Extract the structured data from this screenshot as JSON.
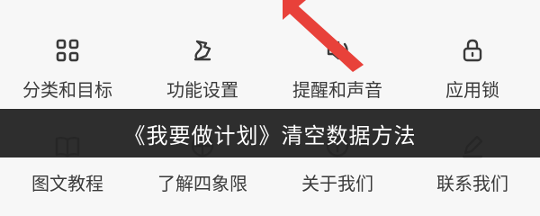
{
  "banner": {
    "text": "《我要做计划》清空数据方法"
  },
  "settings_grid": {
    "row1": [
      {
        "label": "分类和目标",
        "icon": "grid-icon"
      },
      {
        "label": "功能设置",
        "icon": "feature-settings-icon"
      },
      {
        "label": "提醒和声音",
        "icon": "sound-icon"
      },
      {
        "label": "应用锁",
        "icon": "lock-icon"
      }
    ],
    "row2": [
      {
        "label": "图文教程",
        "icon": "book-icon"
      },
      {
        "label": "了解四象限",
        "icon": "quadrant-icon"
      },
      {
        "label": "关于我们",
        "icon": "info-icon"
      },
      {
        "label": "联系我们",
        "icon": "edit-icon"
      }
    ]
  },
  "colors": {
    "arrow": "#e8413a",
    "banner_bg": "#121212",
    "icon_stroke": "#3a3a3a"
  }
}
